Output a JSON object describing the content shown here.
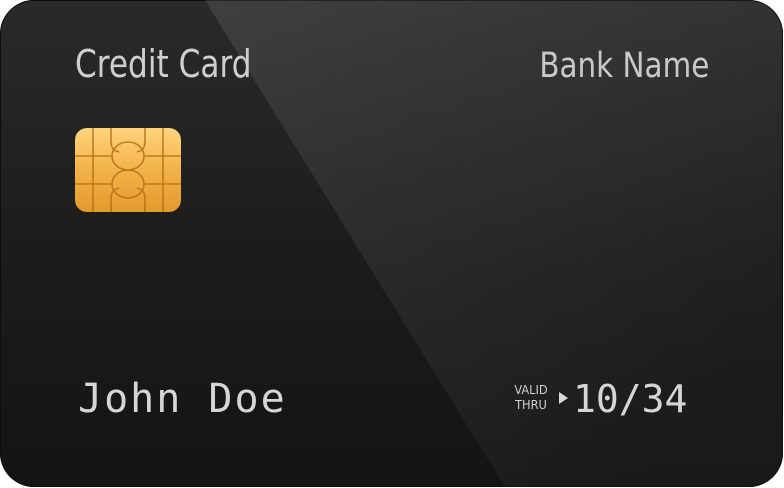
{
  "card": {
    "title": "Credit Card",
    "bank_name": "Bank Name",
    "cardholder_name": "John Doe",
    "valid_thru": {
      "line1": "VALID",
      "line2": "THRU",
      "arrow_icon": "triangle-right-icon"
    },
    "expiry": "10/34",
    "chip_icon": "emv-chip-icon"
  },
  "colors": {
    "card_background": "#1c1c1c",
    "text": "#d0d0d0",
    "chip_gold": "#f2b24a"
  }
}
